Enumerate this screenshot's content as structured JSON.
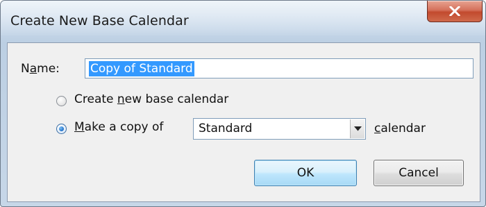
{
  "dialog": {
    "title": "Create New Base Calendar",
    "close_icon": "close-icon"
  },
  "name_field": {
    "label_prefix": "N",
    "label_mnemonic": "a",
    "label_suffix": "me:",
    "value": "Copy of Standard"
  },
  "options": {
    "create_new": {
      "prefix": "Create ",
      "mnemonic": "n",
      "suffix": "ew base calendar",
      "checked": false
    },
    "make_copy": {
      "prefix": "",
      "mnemonic": "M",
      "suffix": "ake a copy of",
      "checked": true
    }
  },
  "calendar_select": {
    "selected": "Standard",
    "arrow_icon": "chevron-down-icon"
  },
  "calendar_label": {
    "mnemonic": "c",
    "suffix": "alendar"
  },
  "buttons": {
    "ok_label": "OK",
    "cancel_label": "Cancel"
  }
}
